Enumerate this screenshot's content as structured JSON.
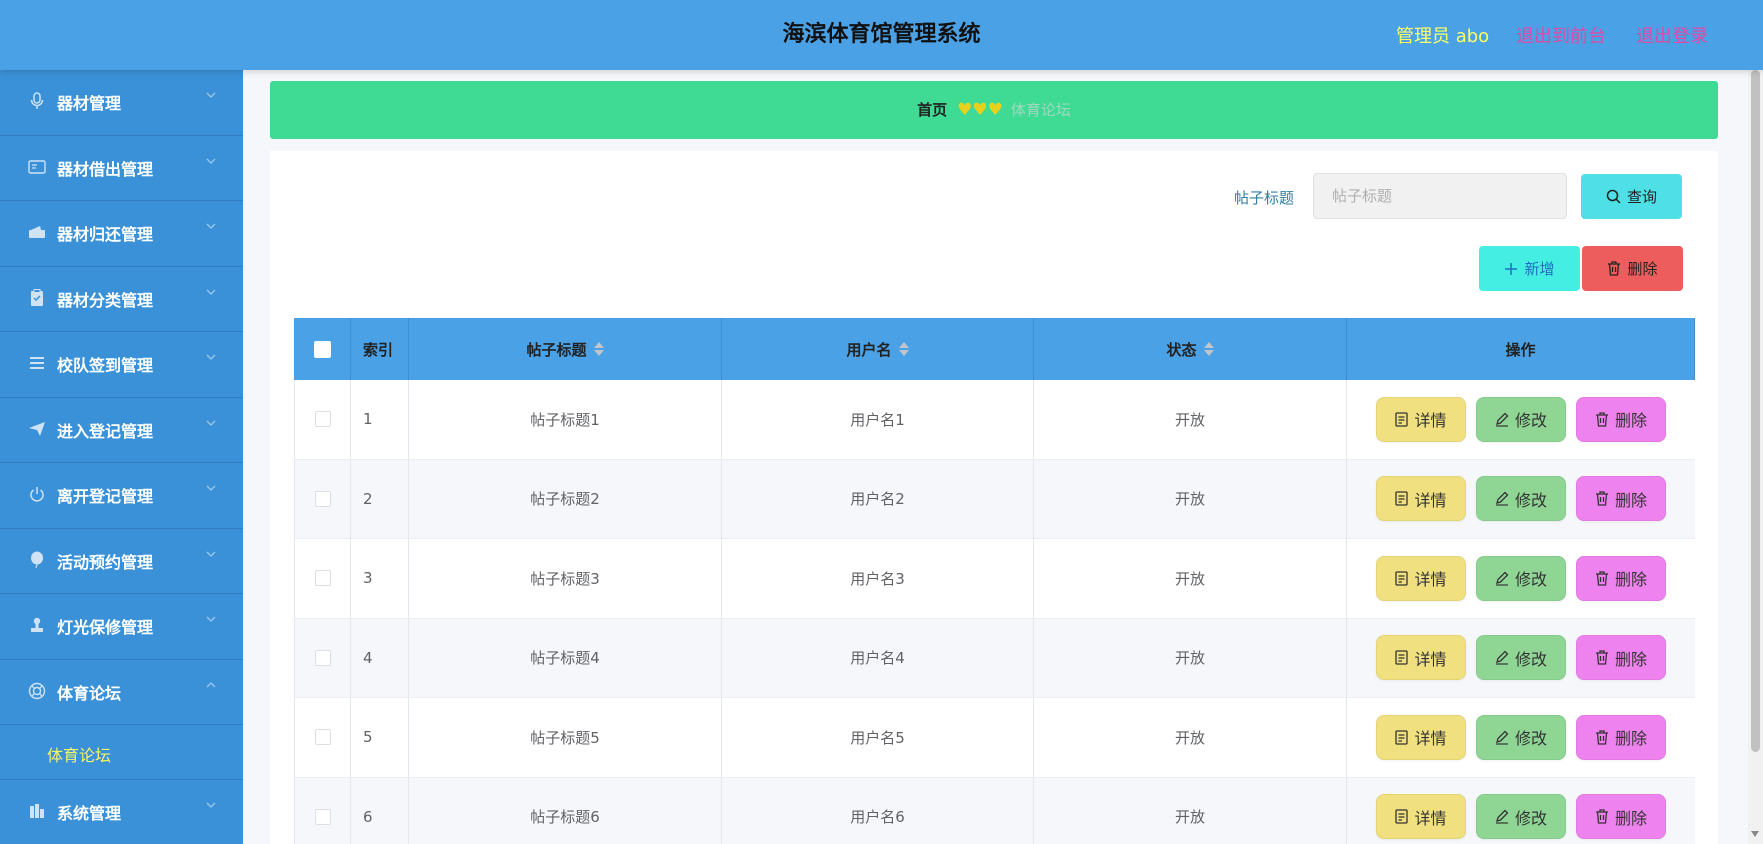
{
  "header": {
    "title": "海滨体育馆管理系统",
    "user": "管理员 abo",
    "exit_front": "退出到前台",
    "logout": "退出登录"
  },
  "sidebar": {
    "items": [
      {
        "label": "器材管理",
        "icon": "microphone-icon"
      },
      {
        "label": "器材借出管理",
        "icon": "id-card-icon"
      },
      {
        "label": "器材归还管理",
        "icon": "wallet-icon"
      },
      {
        "label": "器材分类管理",
        "icon": "clipboard-icon"
      },
      {
        "label": "校队签到管理",
        "icon": "list-icon"
      },
      {
        "label": "进入登记管理",
        "icon": "send-icon"
      },
      {
        "label": "离开登记管理",
        "icon": "power-icon"
      },
      {
        "label": "活动预约管理",
        "icon": "balloon-icon"
      },
      {
        "label": "灯光保修管理",
        "icon": "stamp-icon"
      },
      {
        "label": "体育论坛",
        "icon": "lifebuoy-icon"
      },
      {
        "label": "系统管理",
        "icon": "chart-icon"
      }
    ],
    "submenu_label": "体育论坛"
  },
  "breadcrumb": {
    "home": "首页",
    "hearts": "♥♥♥",
    "current": "体育论坛"
  },
  "search": {
    "label": "帖子标题",
    "placeholder": "帖子标题",
    "value": "",
    "query_button": "查询"
  },
  "actions": {
    "add": "新增",
    "delete": "删除"
  },
  "table": {
    "headers": [
      "索引",
      "帖子标题",
      "用户名",
      "状态",
      "操作"
    ],
    "rows": [
      {
        "index": "1",
        "title": "帖子标题1",
        "user": "用户名1",
        "status": "开放"
      },
      {
        "index": "2",
        "title": "帖子标题2",
        "user": "用户名2",
        "status": "开放"
      },
      {
        "index": "3",
        "title": "帖子标题3",
        "user": "用户名3",
        "status": "开放"
      },
      {
        "index": "4",
        "title": "帖子标题4",
        "user": "用户名4",
        "status": "开放"
      },
      {
        "index": "5",
        "title": "帖子标题5",
        "user": "用户名5",
        "status": "开放"
      },
      {
        "index": "6",
        "title": "帖子标题6",
        "user": "用户名6",
        "status": "开放"
      }
    ],
    "row_buttons": {
      "detail": "详情",
      "edit": "修改",
      "remove": "删除"
    }
  },
  "colors": {
    "header_bg": "#4aa1e6",
    "sidebar_bg": "#3a91d8",
    "breadcrumb_bg": "#3fdb95",
    "detail_btn": "#f1e07f",
    "edit_btn": "#8fd694",
    "remove_btn": "#ee82ee"
  }
}
